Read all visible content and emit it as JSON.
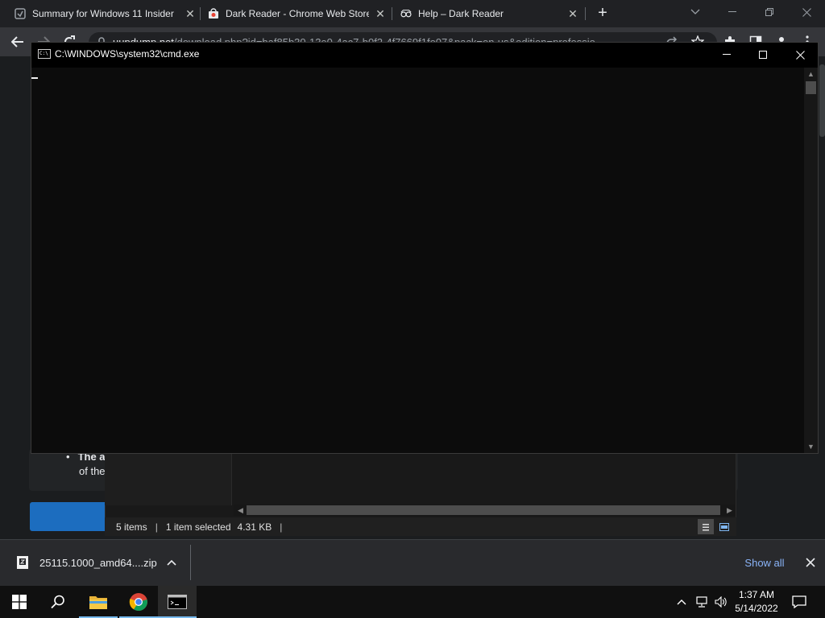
{
  "browser": {
    "tabs": [
      {
        "title": "Summary for Windows 11 Insider",
        "close": "✕"
      },
      {
        "title": "Dark Reader - Chrome Web Store",
        "close": "✕"
      },
      {
        "title": "Help – Dark Reader",
        "close": "✕"
      }
    ],
    "new_tab": "+",
    "address_host": "uupdump.net",
    "address_rest": "/download.php?id=baf85b30-13e0-4ac7-b0f2-4f7669f1fe07&pack=en-us&edition=professio"
  },
  "page": {
    "bullet_bold": "The a",
    "bullet_line2": "of the"
  },
  "cmd": {
    "title": "C:\\WINDOWS\\system32\\cmd.exe"
  },
  "explorer": {
    "status_items": "5 items",
    "status_selected": "1 item selected",
    "status_size": "4.31 KB"
  },
  "downloads": {
    "file_name": "25115.1000_amd64....zip",
    "show_all": "Show all"
  },
  "taskbar": {
    "time": "1:37 AM",
    "date": "5/14/2022"
  },
  "colors": {
    "accent": "#8ab4f8",
    "taskbar_active": "#76b9ed"
  }
}
